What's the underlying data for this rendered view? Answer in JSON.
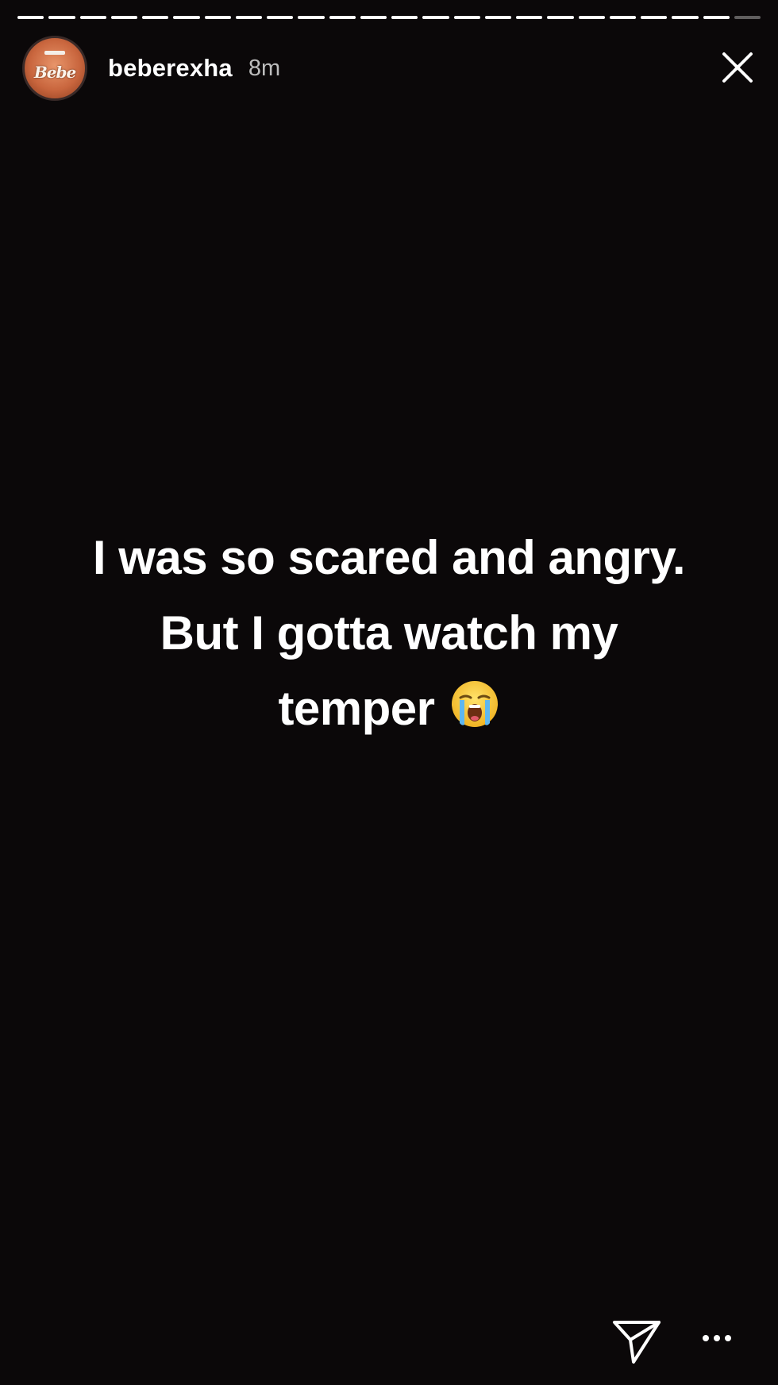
{
  "story": {
    "progress": {
      "segments_total": 24,
      "segments_viewed": 23
    },
    "header": {
      "avatar_text": "Bebe",
      "username": "beberexha",
      "time_ago": "8m"
    },
    "caption": {
      "line1": "I was so scared and angry.",
      "line2": "But I gotta watch my",
      "line3": "temper",
      "emoji": "loudly-crying-face"
    },
    "actions": {
      "close_icon": "close-icon",
      "send_icon": "direct-send-icon",
      "more_icon": "more-options-icon"
    },
    "colors": {
      "background": "#0b0809",
      "text": "#ffffff",
      "timestamp": "#bdbdbd",
      "avatar_accent": "#c9663e"
    }
  }
}
